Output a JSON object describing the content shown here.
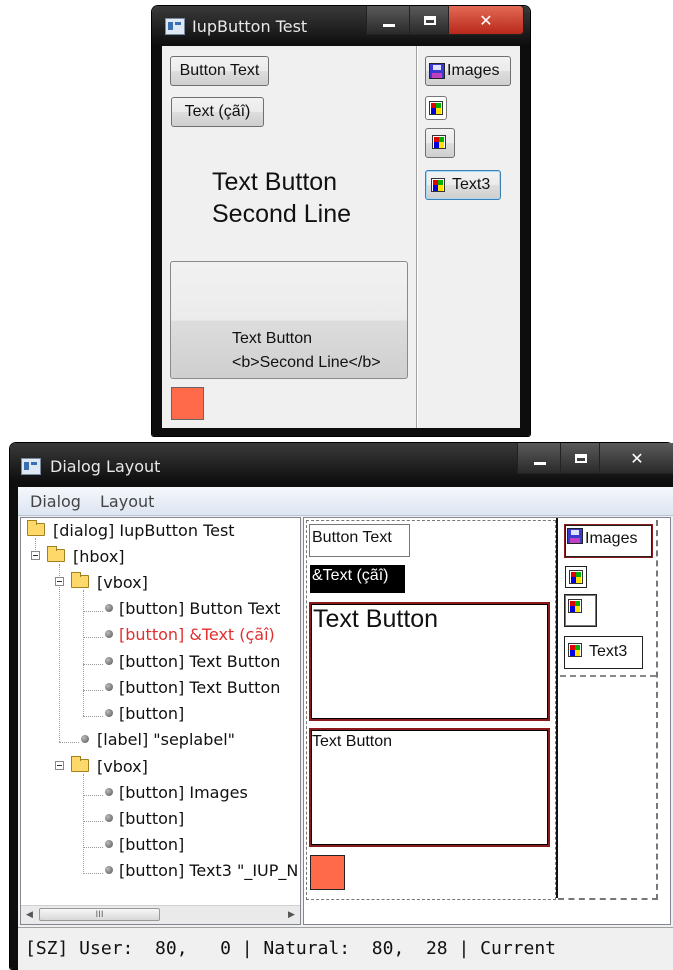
{
  "test_window": {
    "title": "IupButton Test",
    "buttons": {
      "button_text": "Button Text",
      "text_cai": "Text (çãî)",
      "text_button_line1": "Text Button",
      "text_button_line2": "Second Line",
      "markup_line1": "Text Button",
      "markup_line2": "<b>Second Line</b>",
      "images": "Images",
      "text3": "Text3"
    },
    "color_button": "#ff6a4a"
  },
  "layout_window": {
    "title": "Dialog Layout",
    "menu": [
      "Dialog",
      "Layout"
    ],
    "tree": [
      "[dialog] IupButton Test",
      "[hbox]",
      "[vbox]",
      "[button] Button Text",
      "[button] &Text (çãî)",
      "[button] Text Button",
      "[button] Text Button",
      "[button]",
      "[label] \"seplabel\"",
      "[vbox]",
      "[button] Images",
      "[button]",
      "[button]",
      "[button] Text3 \"_IUP_N"
    ],
    "selected_index": 4,
    "scroll_thumb_glyph": "III",
    "canvas": {
      "button_text": "Button Text",
      "text_cai": "&Text (çãî)",
      "text_button_big": "Text Button",
      "text_button_small": "Text Button",
      "images": "Images",
      "text3": "Text3"
    },
    "status": "[SZ] User:  80,   0 | Natural:  80,  28 | Current"
  }
}
